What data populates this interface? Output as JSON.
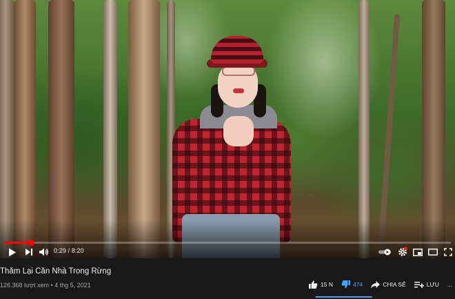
{
  "video": {
    "progress_fraction": 0.06,
    "time_current": "0:29",
    "time_separator": " / ",
    "time_total": "8:20"
  },
  "player_icons": [
    "play-icon",
    "next-icon",
    "volume-icon",
    "autoplay-toggle",
    "settings-icon",
    "miniplayer-icon",
    "theater-icon",
    "fullscreen-icon"
  ],
  "colors": {
    "progress": "#ff0000",
    "accent_blue": "#3ea6ff",
    "background": "#181818"
  },
  "info": {
    "title": "Thăm Lại Căn Nhà Trong Rừng",
    "views": "126.368 lượt xem",
    "dot": " • ",
    "date": "4 thg 5, 2021",
    "like_count": "15 N",
    "dislike_count": "474",
    "share_label": "CHIA SẺ",
    "save_label": "LƯU",
    "more_label": "..."
  },
  "rating_fraction": 0.97
}
